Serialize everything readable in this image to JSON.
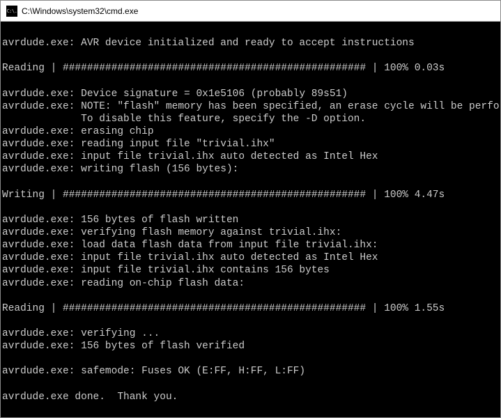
{
  "window": {
    "title": "C:\\Windows\\system32\\cmd.exe",
    "icon_text": "C:\\."
  },
  "terminal": {
    "lines": [
      "",
      "avrdude.exe: AVR device initialized and ready to accept instructions",
      "",
      "Reading | ################################################## | 100% 0.03s",
      "",
      "avrdude.exe: Device signature = 0x1e5106 (probably 89s51)",
      "avrdude.exe: NOTE: \"flash\" memory has been specified, an erase cycle will be performe",
      "             To disable this feature, specify the -D option.",
      "avrdude.exe: erasing chip",
      "avrdude.exe: reading input file \"trivial.ihx\"",
      "avrdude.exe: input file trivial.ihx auto detected as Intel Hex",
      "avrdude.exe: writing flash (156 bytes):",
      "",
      "Writing | ################################################## | 100% 4.47s",
      "",
      "avrdude.exe: 156 bytes of flash written",
      "avrdude.exe: verifying flash memory against trivial.ihx:",
      "avrdude.exe: load data flash data from input file trivial.ihx:",
      "avrdude.exe: input file trivial.ihx auto detected as Intel Hex",
      "avrdude.exe: input file trivial.ihx contains 156 bytes",
      "avrdude.exe: reading on-chip flash data:",
      "",
      "Reading | ################################################## | 100% 1.55s",
      "",
      "avrdude.exe: verifying ...",
      "avrdude.exe: 156 bytes of flash verified",
      "",
      "avrdude.exe: safemode: Fuses OK (E:FF, H:FF, L:FF)",
      "",
      "avrdude.exe done.  Thank you."
    ]
  }
}
